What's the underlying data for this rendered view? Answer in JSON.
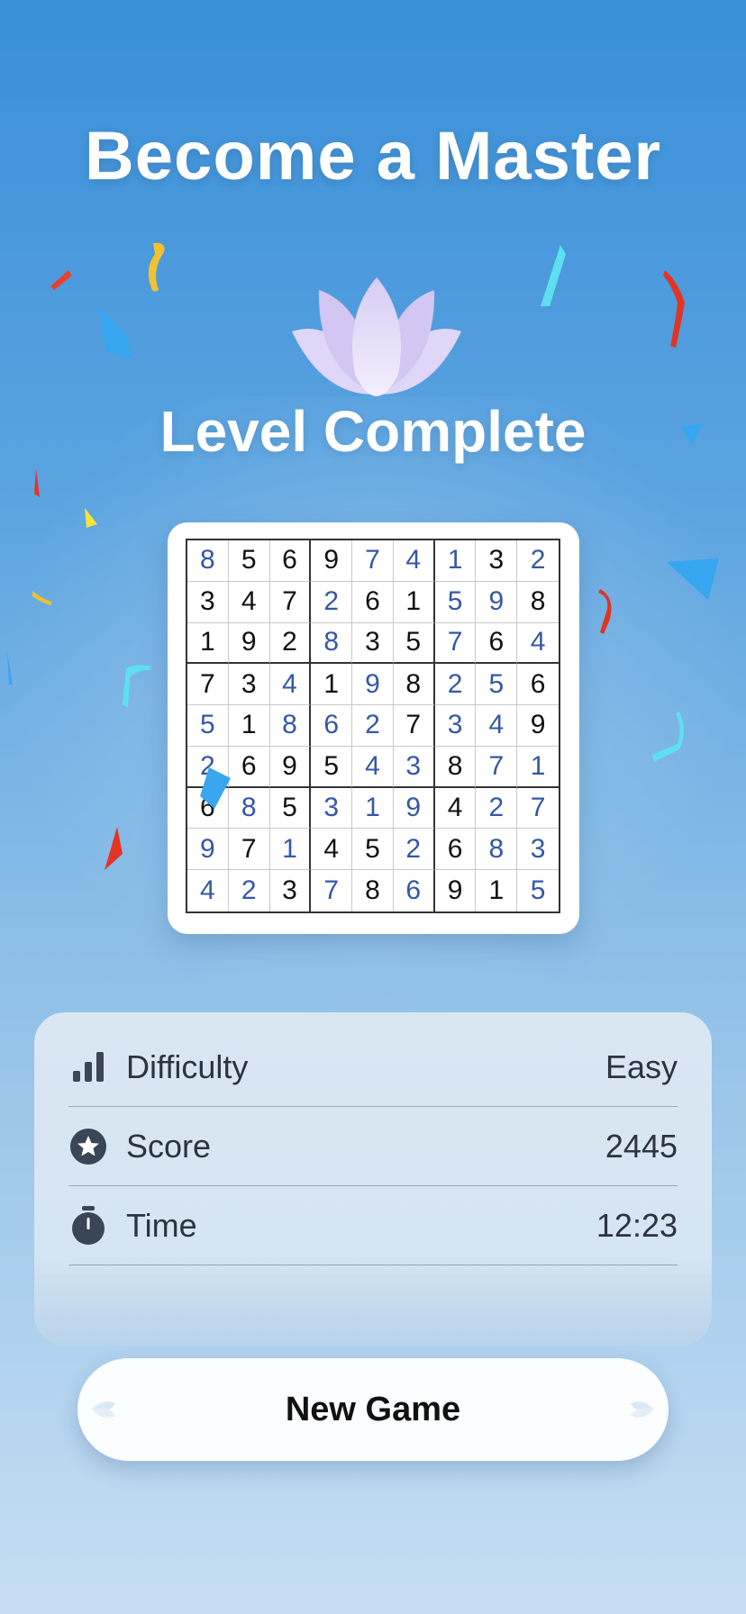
{
  "header": {
    "title": "Become a Master",
    "subtitle": "Level Complete"
  },
  "board": {
    "rows": [
      [
        8,
        5,
        6,
        9,
        7,
        4,
        1,
        3,
        2
      ],
      [
        3,
        4,
        7,
        2,
        6,
        1,
        5,
        9,
        8
      ],
      [
        1,
        9,
        2,
        8,
        3,
        5,
        7,
        6,
        4
      ],
      [
        7,
        3,
        4,
        1,
        9,
        8,
        2,
        5,
        6
      ],
      [
        5,
        1,
        8,
        6,
        2,
        7,
        3,
        4,
        9
      ],
      [
        2,
        6,
        9,
        5,
        4,
        3,
        8,
        7,
        1
      ],
      [
        6,
        8,
        5,
        3,
        1,
        9,
        4,
        2,
        7
      ],
      [
        9,
        7,
        1,
        4,
        5,
        2,
        6,
        8,
        3
      ],
      [
        4,
        2,
        3,
        7,
        8,
        6,
        9,
        1,
        5
      ]
    ],
    "user_filled": [
      [
        1,
        0,
        0,
        0,
        1,
        1,
        1,
        0,
        1
      ],
      [
        0,
        0,
        0,
        1,
        0,
        0,
        1,
        1,
        0
      ],
      [
        0,
        0,
        0,
        1,
        0,
        0,
        1,
        0,
        1
      ],
      [
        0,
        0,
        1,
        0,
        1,
        0,
        1,
        1,
        0
      ],
      [
        1,
        0,
        1,
        1,
        1,
        0,
        1,
        1,
        0
      ],
      [
        1,
        0,
        0,
        0,
        1,
        1,
        0,
        1,
        1
      ],
      [
        0,
        1,
        0,
        1,
        1,
        1,
        0,
        1,
        1
      ],
      [
        1,
        0,
        1,
        0,
        0,
        1,
        0,
        1,
        1
      ],
      [
        1,
        1,
        0,
        1,
        0,
        1,
        0,
        0,
        1
      ]
    ],
    "colors": {
      "given": "#111111",
      "filled": "#3557a6"
    }
  },
  "stats": {
    "difficulty": {
      "label": "Difficulty",
      "value": "Easy",
      "icon": "bar-chart-icon"
    },
    "score": {
      "label": "Score",
      "value": "2445",
      "icon": "star-circle-icon"
    },
    "time": {
      "label": "Time",
      "value": "12:23",
      "icon": "stopwatch-icon"
    }
  },
  "actions": {
    "new_game": "New Game"
  }
}
